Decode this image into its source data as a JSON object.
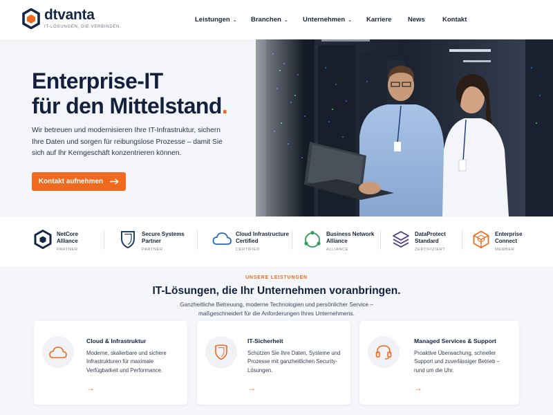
{
  "brand": {
    "name": "dtvanta",
    "tagline": "IT-LÖSUNGEN, DIE VERBINDEN.",
    "accent": "#ef6a1f",
    "navy": "#14213d"
  },
  "nav": {
    "items": [
      {
        "label": "Leistungen",
        "dropdown": true
      },
      {
        "label": "Branchen",
        "dropdown": true
      },
      {
        "label": "Unternehmen",
        "dropdown": true
      },
      {
        "label": "Karriere",
        "dropdown": false
      },
      {
        "label": "News",
        "dropdown": false
      },
      {
        "label": "Kontakt",
        "dropdown": false
      }
    ]
  },
  "hero": {
    "title_line1": "Enterprise-IT",
    "title_line2": "für den Mittelstand",
    "title_dot": ".",
    "text": "Wir betreuen und modernisieren Ihre IT-Infrastruktur, sichern Ihre Daten und sorgen für reibungslose Prozesse – damit Sie sich auf Ihr Kerngeschäft konzentrieren können.",
    "cta_label": "Kontakt aufnehmen",
    "cta_icon": "arrow-right-icon"
  },
  "partners": [
    {
      "name": "NetCore\nAlliance",
      "type": "PARTNER",
      "icon": "hexagon-icon",
      "color": "#152744"
    },
    {
      "name": "Secure Systems\nPartner",
      "type": "PARTNER",
      "icon": "shield-icon",
      "color": "#1d3f63"
    },
    {
      "name": "Cloud Infrastructure\nCertified",
      "type": "CERTIFIED",
      "icon": "cloud-icon",
      "color": "#2b6cb0"
    },
    {
      "name": "Business Network\nAlliance",
      "type": "ALLIANCE",
      "icon": "network-icon",
      "color": "#2f9e5b"
    },
    {
      "name": "DataProtect\nStandard",
      "type": "ZERTIFIZIERT",
      "icon": "layers-icon",
      "color": "#4b3a8c"
    },
    {
      "name": "Enterprise\nConnect",
      "type": "MEMBER",
      "icon": "cube-icon",
      "color": "#ef6a1f"
    }
  ],
  "services": {
    "eyebrow": "UNSERE LEISTUNGEN",
    "title": "IT-Lösungen, die Ihr Unternehmen voranbringen.",
    "subtitle_line1": "Ganzheitliche Betreuung, moderne Technologien und persönlicher Service –",
    "subtitle_line2": "maßgeschneidert für die Anforderungen Ihres Unternehmens.",
    "cards": [
      {
        "title": "Cloud & Infrastruktur",
        "text": "Moderne, skalierbare und sichere Infrastrukturen für maximale Verfügbarkeit und Performance.",
        "icon": "cloud-icon",
        "arrow": "→"
      },
      {
        "title": "IT-Sicherheit",
        "text": "Schützen Sie Ihre Daten, Systeme und Prozesse mit ganzheitlichen Security-Lösungen.",
        "icon": "shield-icon",
        "arrow": "→"
      },
      {
        "title": "Managed Services & Support",
        "text": "Proaktive Überwachung, schneller Support und zuverlässiger Betrieb – rund um die Uhr.",
        "icon": "headset-icon",
        "arrow": "→"
      }
    ]
  }
}
